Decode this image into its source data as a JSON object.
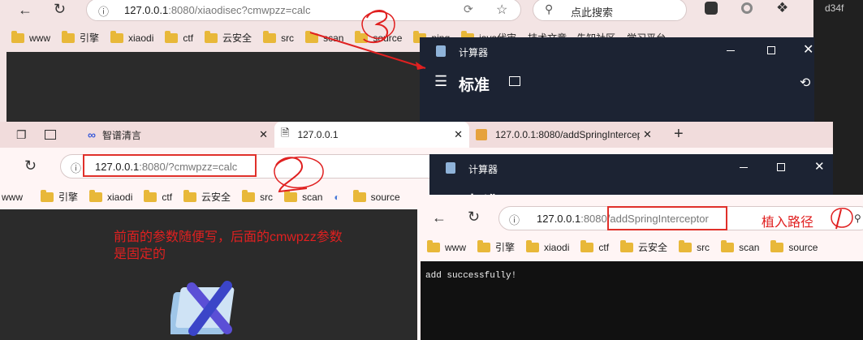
{
  "window_back": {
    "url_host": "127.0.0.1",
    "url_rest": ":8080/xiaodisec?cmwpzz=calc",
    "search_placeholder": "点此搜索",
    "corner_text": "d34f",
    "bookmarks": [
      "www",
      "引擎",
      "xiaodi",
      "ctf",
      "云安全",
      "src",
      "scan",
      "source",
      "ping",
      "java代审",
      "技术文章、先知社区",
      "学习平台"
    ]
  },
  "calc_top": {
    "title": "计算器",
    "mode": "标准"
  },
  "window_middle": {
    "tabs": [
      {
        "label": "智谱清言"
      },
      {
        "label": "127.0.0.1"
      },
      {
        "label": "127.0.0.1:8080/addSpringIntercep"
      }
    ],
    "url_host": "127.0.0.1",
    "url_rest": ":8080/?cmwpzz=calc",
    "bookmarks": [
      "www",
      "引擎",
      "xiaodi",
      "ctf",
      "云安全",
      "src",
      "scan",
      "source"
    ],
    "annotation_line1": "前面的参数随便写，后面的cmwpzz参数",
    "annotation_line2": "是固定的"
  },
  "calc_middle": {
    "title": "计算器",
    "mode": "标准"
  },
  "window_front": {
    "url_host": "127.0.0.1",
    "url_rest": ":8080/addSpringInterceptor",
    "annotation": "植入路径",
    "bookmarks": [
      "www",
      "引擎",
      "xiaodi",
      "ctf",
      "云安全",
      "src",
      "scan",
      "source"
    ],
    "body_text": "add successfully!"
  },
  "colors": {
    "annotation_red": "#e02020",
    "calc_bg": "#1c2333",
    "tabbar_pink": "#f1dcdc"
  }
}
